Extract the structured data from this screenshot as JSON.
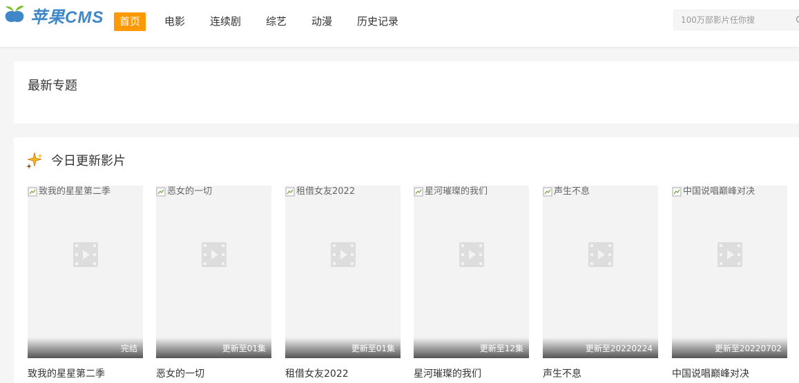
{
  "site": {
    "logo_text": "苹果CMS",
    "nav": [
      {
        "label": "首页"
      },
      {
        "label": "电影"
      },
      {
        "label": "连续剧"
      },
      {
        "label": "综艺"
      },
      {
        "label": "动漫"
      },
      {
        "label": "历史记录"
      }
    ],
    "search": {
      "placeholder": "100万部影片任你搜"
    },
    "accent_color": "#ff9900"
  },
  "topics": {
    "title": "最新专题"
  },
  "today": {
    "title": "今日更新影片",
    "items": [
      {
        "alt": "致我的星星第二季",
        "title": "致我的星星第二季",
        "badge": "完结"
      },
      {
        "alt": "恶女的一切",
        "title": "恶女的一切",
        "badge": "更新至01集"
      },
      {
        "alt": "租借女友2022",
        "title": "租借女友2022",
        "badge": "更新至01集"
      },
      {
        "alt": "星河璀璨的我们",
        "title": "星河璀璨的我们",
        "badge": "更新至12集"
      },
      {
        "alt": "声生不息",
        "title": "声生不息",
        "badge": "更新至20220224"
      },
      {
        "alt": "中国说唱巅峰对决",
        "title": "中国说唱巅峰对决",
        "badge": "更新至20220702"
      }
    ]
  }
}
